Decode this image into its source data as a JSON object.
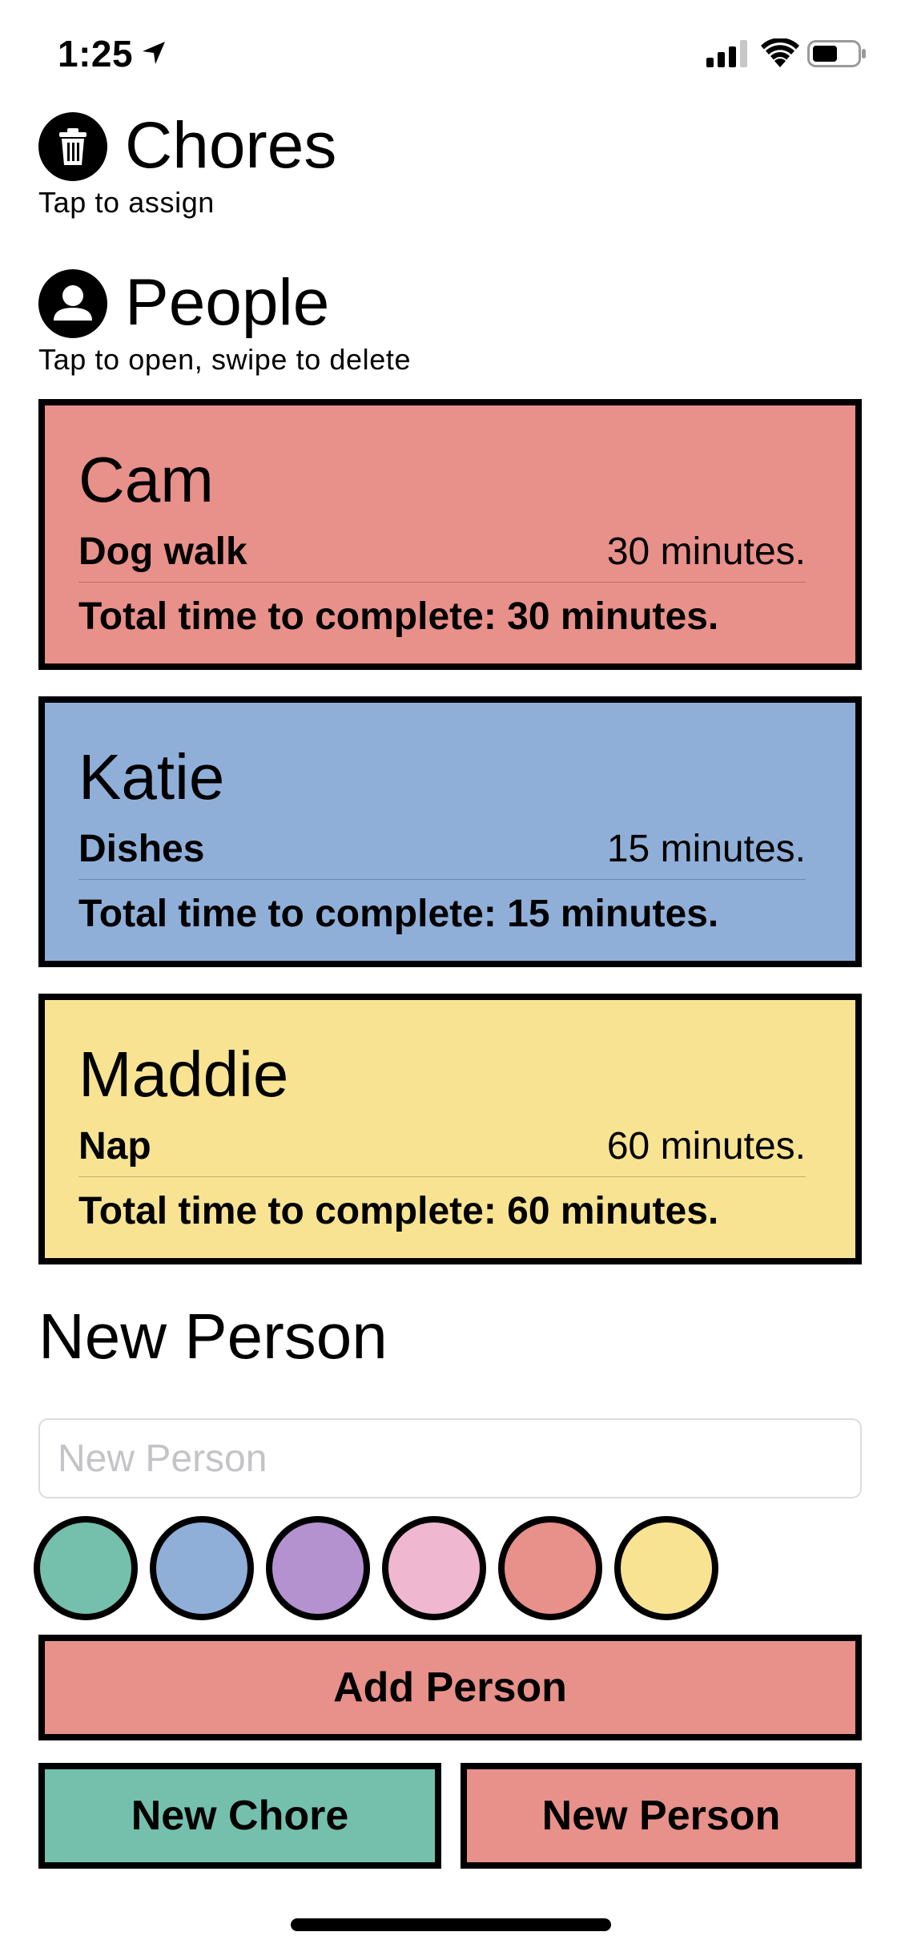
{
  "status_bar": {
    "time": "1:25",
    "icons": [
      "location-arrow-icon",
      "cellular-signal-icon",
      "wifi-icon",
      "battery-icon"
    ]
  },
  "chores_section": {
    "icon": "trash-icon",
    "title": "Chores",
    "subtitle": "Tap to assign"
  },
  "people_section": {
    "icon": "person-icon",
    "title": "People",
    "subtitle": "Tap to open, swipe to delete"
  },
  "people": [
    {
      "name": "Cam",
      "color": "#e8908a",
      "chores": [
        {
          "name": "Dog walk",
          "time": "30 minutes."
        }
      ],
      "total": "Total time to complete: 30 minutes."
    },
    {
      "name": "Katie",
      "color": "#8fafd8",
      "chores": [
        {
          "name": "Dishes",
          "time": "15 minutes."
        }
      ],
      "total": "Total time to complete: 15 minutes."
    },
    {
      "name": "Maddie",
      "color": "#f7e392",
      "chores": [
        {
          "name": "Nap",
          "time": "60 minutes."
        }
      ],
      "total": "Total time to complete: 60 minutes."
    }
  ],
  "new_person_form": {
    "title": "New Person",
    "input_value": "",
    "input_placeholder": "New Person",
    "color_options": [
      "#74c0ad",
      "#8fafd8",
      "#b491cf",
      "#efb7d0",
      "#e8908a",
      "#f7e392"
    ],
    "add_button_label": "Add Person",
    "add_button_color": "#e8908a"
  },
  "bottom_buttons": {
    "new_chore": {
      "label": "New Chore",
      "color": "#74c0ad"
    },
    "new_person": {
      "label": "New Person",
      "color": "#e8908a"
    }
  }
}
